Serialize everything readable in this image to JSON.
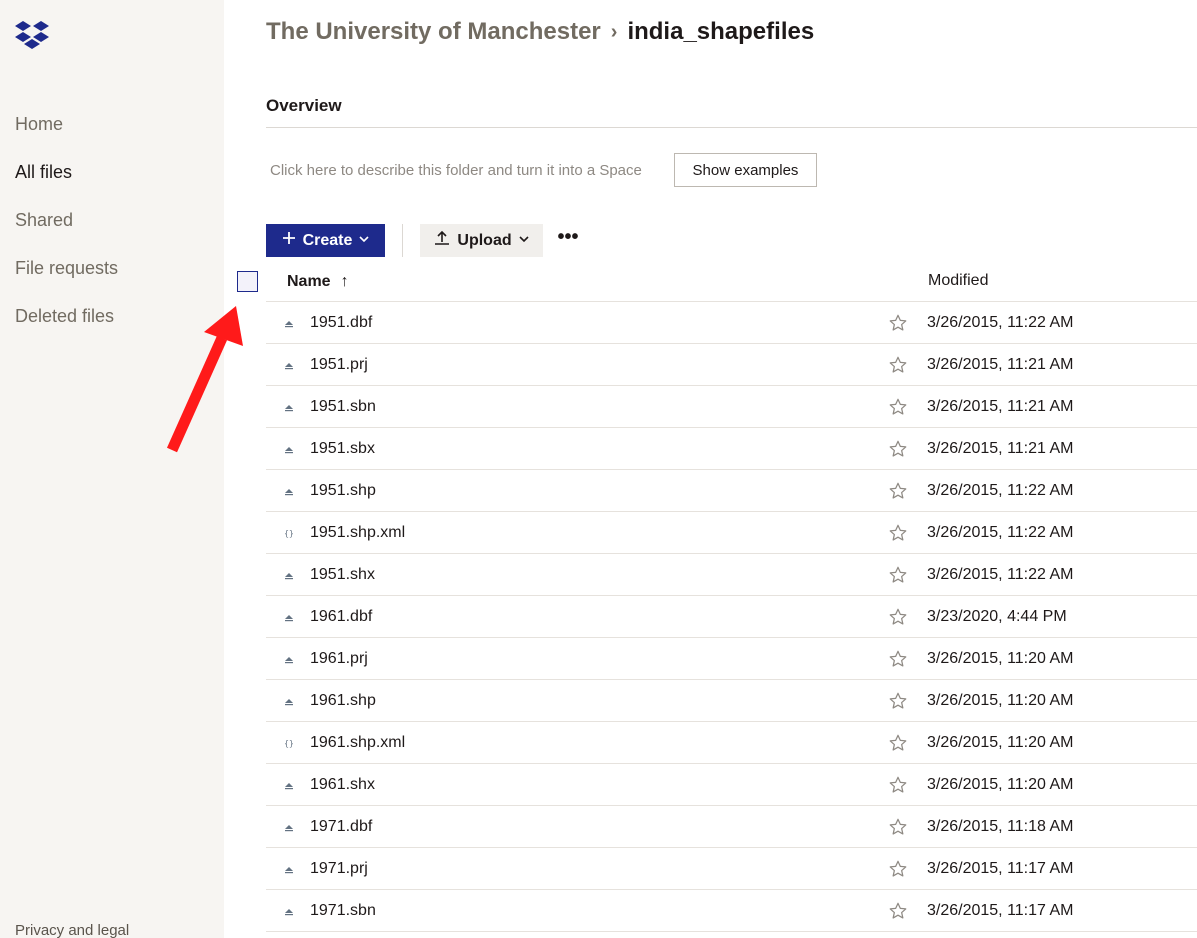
{
  "sidebar": {
    "items": [
      {
        "label": "Home"
      },
      {
        "label": "All files"
      },
      {
        "label": "Shared"
      },
      {
        "label": "File requests"
      },
      {
        "label": "Deleted files"
      }
    ],
    "active": "All files",
    "footer": "Privacy and legal"
  },
  "breadcrumb": {
    "parent": "The University of Manchester",
    "separator": "›",
    "current": "india_shapefiles"
  },
  "overview": {
    "tab": "Overview",
    "describe_placeholder": "Click here to describe this folder and turn it into a Space",
    "show_examples": "Show examples"
  },
  "toolbar": {
    "create_label": "Create",
    "upload_label": "Upload",
    "more_label": "•••"
  },
  "table": {
    "columns": {
      "name": "Name",
      "modified": "Modified"
    },
    "sort_arrow": "↑",
    "rows": [
      {
        "name": "1951.dbf",
        "modified": "3/26/2015, 11:22 AM",
        "icon": "file-icon"
      },
      {
        "name": "1951.prj",
        "modified": "3/26/2015, 11:21 AM",
        "icon": "file-icon"
      },
      {
        "name": "1951.sbn",
        "modified": "3/26/2015, 11:21 AM",
        "icon": "file-icon"
      },
      {
        "name": "1951.sbx",
        "modified": "3/26/2015, 11:21 AM",
        "icon": "file-icon"
      },
      {
        "name": "1951.shp",
        "modified": "3/26/2015, 11:22 AM",
        "icon": "file-icon"
      },
      {
        "name": "1951.shp.xml",
        "modified": "3/26/2015, 11:22 AM",
        "icon": "code-file-icon"
      },
      {
        "name": "1951.shx",
        "modified": "3/26/2015, 11:22 AM",
        "icon": "file-icon"
      },
      {
        "name": "1961.dbf",
        "modified": "3/23/2020, 4:44 PM",
        "icon": "file-icon"
      },
      {
        "name": "1961.prj",
        "modified": "3/26/2015, 11:20 AM",
        "icon": "file-icon"
      },
      {
        "name": "1961.shp",
        "modified": "3/26/2015, 11:20 AM",
        "icon": "file-icon"
      },
      {
        "name": "1961.shp.xml",
        "modified": "3/26/2015, 11:20 AM",
        "icon": "code-file-icon"
      },
      {
        "name": "1961.shx",
        "modified": "3/26/2015, 11:20 AM",
        "icon": "file-icon"
      },
      {
        "name": "1971.dbf",
        "modified": "3/26/2015, 11:18 AM",
        "icon": "file-icon"
      },
      {
        "name": "1971.prj",
        "modified": "3/26/2015, 11:17 AM",
        "icon": "file-icon"
      },
      {
        "name": "1971.sbn",
        "modified": "3/26/2015, 11:17 AM",
        "icon": "file-icon"
      }
    ]
  },
  "colors": {
    "accent": "#1e2a8c",
    "annotation": "#ff1a1a",
    "sidebar_bg": "#f7f5f2"
  }
}
